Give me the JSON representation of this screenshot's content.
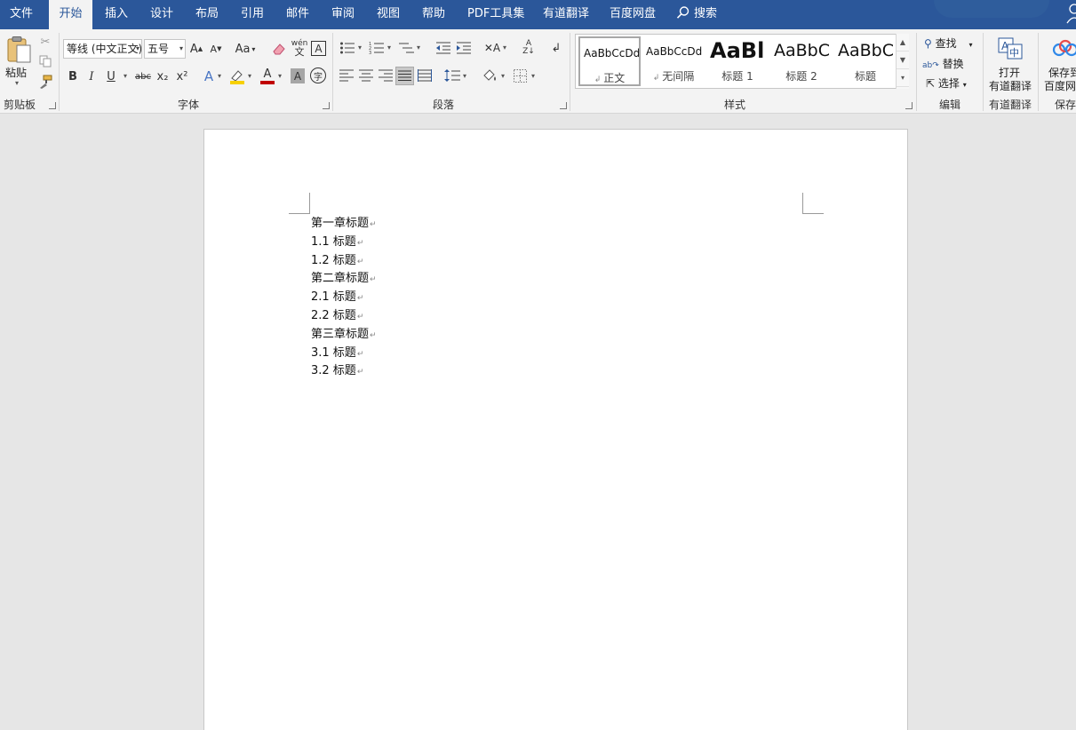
{
  "menubar": {
    "tabs": [
      {
        "label": "文件",
        "active": false
      },
      {
        "label": "开始",
        "active": true
      },
      {
        "label": "插入",
        "active": false
      },
      {
        "label": "设计",
        "active": false
      },
      {
        "label": "布局",
        "active": false
      },
      {
        "label": "引用",
        "active": false
      },
      {
        "label": "邮件",
        "active": false
      },
      {
        "label": "审阅",
        "active": false
      },
      {
        "label": "视图",
        "active": false
      },
      {
        "label": "帮助",
        "active": false
      },
      {
        "label": "PDF工具集",
        "active": false
      },
      {
        "label": "有道翻译",
        "active": false
      },
      {
        "label": "百度网盘",
        "active": false
      }
    ],
    "search_label": "搜索"
  },
  "ribbon": {
    "clipboard": {
      "paste_label": "粘贴",
      "group_label": "剪贴板"
    },
    "font": {
      "font_name": "等线 (中文正文)",
      "font_size": "五号",
      "group_label": "字体",
      "bold": "B",
      "italic": "I",
      "underline": "U",
      "strike": "abc",
      "subscript": "x₂",
      "superscript": "x²",
      "grow": "A",
      "shrink": "A",
      "case": "Aa",
      "phonetic": "wén",
      "border_char": "A",
      "shade_char": "A",
      "circle_char": "字"
    },
    "paragraph": {
      "group_label": "段落"
    },
    "styles": {
      "group_label": "样式",
      "items": [
        {
          "sample": "AaBbCcDd",
          "name": "正文",
          "selected": true
        },
        {
          "sample": "AaBbCcDd",
          "name": "无间隔",
          "selected": false
        },
        {
          "sample": "AaBl",
          "name": "标题 1",
          "selected": false
        },
        {
          "sample": "AaBbC",
          "name": "标题 2",
          "selected": false
        },
        {
          "sample": "AaBbC",
          "name": "标题",
          "selected": false
        }
      ]
    },
    "editing": {
      "find": "查找",
      "replace": "替换",
      "select": "选择",
      "group_label": "编辑"
    },
    "youdao": {
      "line1": "打开",
      "line2": "有道翻译",
      "group_label": "有道翻译"
    },
    "baidu": {
      "line1": "保存到",
      "line2": "百度网盘",
      "group_label": "保存"
    }
  },
  "document": {
    "lines": [
      "第一章标题",
      "1.1 标题",
      "1.2 标题",
      "第二章标题",
      "2.1 标题",
      "2.2 标题",
      "第三章标题",
      "3.1 标题",
      "3.2 标题"
    ],
    "paragraph_mark": "↵"
  },
  "colors": {
    "accent": "#2b579a",
    "ribbon_bg": "#f3f3f3",
    "doc_bg": "#e6e6e6"
  }
}
